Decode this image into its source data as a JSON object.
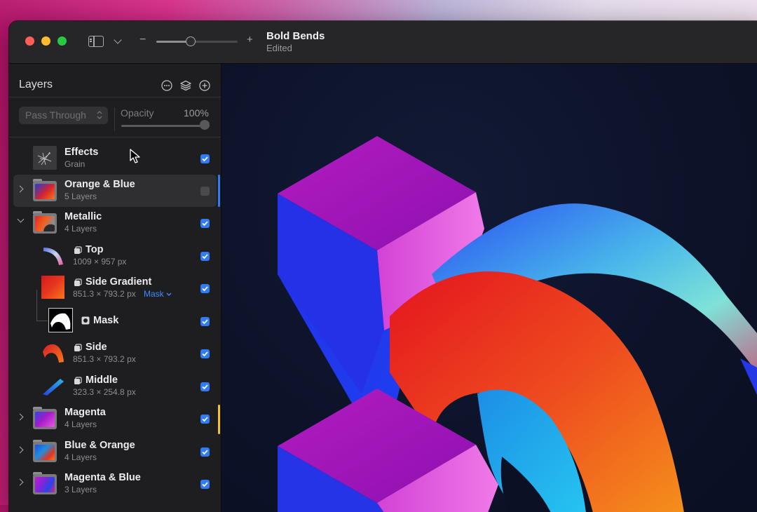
{
  "window": {
    "title": "Bold Bends",
    "subtitle": "Edited"
  },
  "toolbar": {
    "zoom_minus": "−",
    "zoom_plus": "+",
    "zoom_level": 0.43
  },
  "layers_panel": {
    "title": "Layers",
    "blend_mode": "Pass Through",
    "opacity_label": "Opacity",
    "opacity_value": "100%",
    "layers": [
      {
        "name": "Effects",
        "sub": "Grain",
        "checked": true
      },
      {
        "name": "Orange & Blue",
        "sub": "5 Layers",
        "checked": false,
        "selected": true
      },
      {
        "name": "Metallic",
        "sub": "4 Layers",
        "checked": true,
        "expanded": true
      },
      {
        "name": "Top",
        "sub": "1009 × 957 px",
        "checked": true
      },
      {
        "name": "Side Gradient",
        "sub": "851.3 × 793.2 px",
        "mask_link": "Mask",
        "checked": true
      },
      {
        "name": "Mask",
        "checked": true
      },
      {
        "name": "Side",
        "sub": "851.3 × 793.2 px",
        "checked": true
      },
      {
        "name": "Middle",
        "sub": "323.3 × 254.8 px",
        "checked": true
      },
      {
        "name": "Magenta",
        "sub": "4 Layers",
        "checked": true
      },
      {
        "name": "Blue & Orange",
        "sub": "4 Layers",
        "checked": true
      },
      {
        "name": "Magenta & Blue",
        "sub": "3 Layers",
        "checked": true
      }
    ]
  },
  "colors": {
    "accent": "#2f7cf6",
    "selection_marker": "#2f7cf6",
    "magenta_marker": "#f4c430"
  }
}
